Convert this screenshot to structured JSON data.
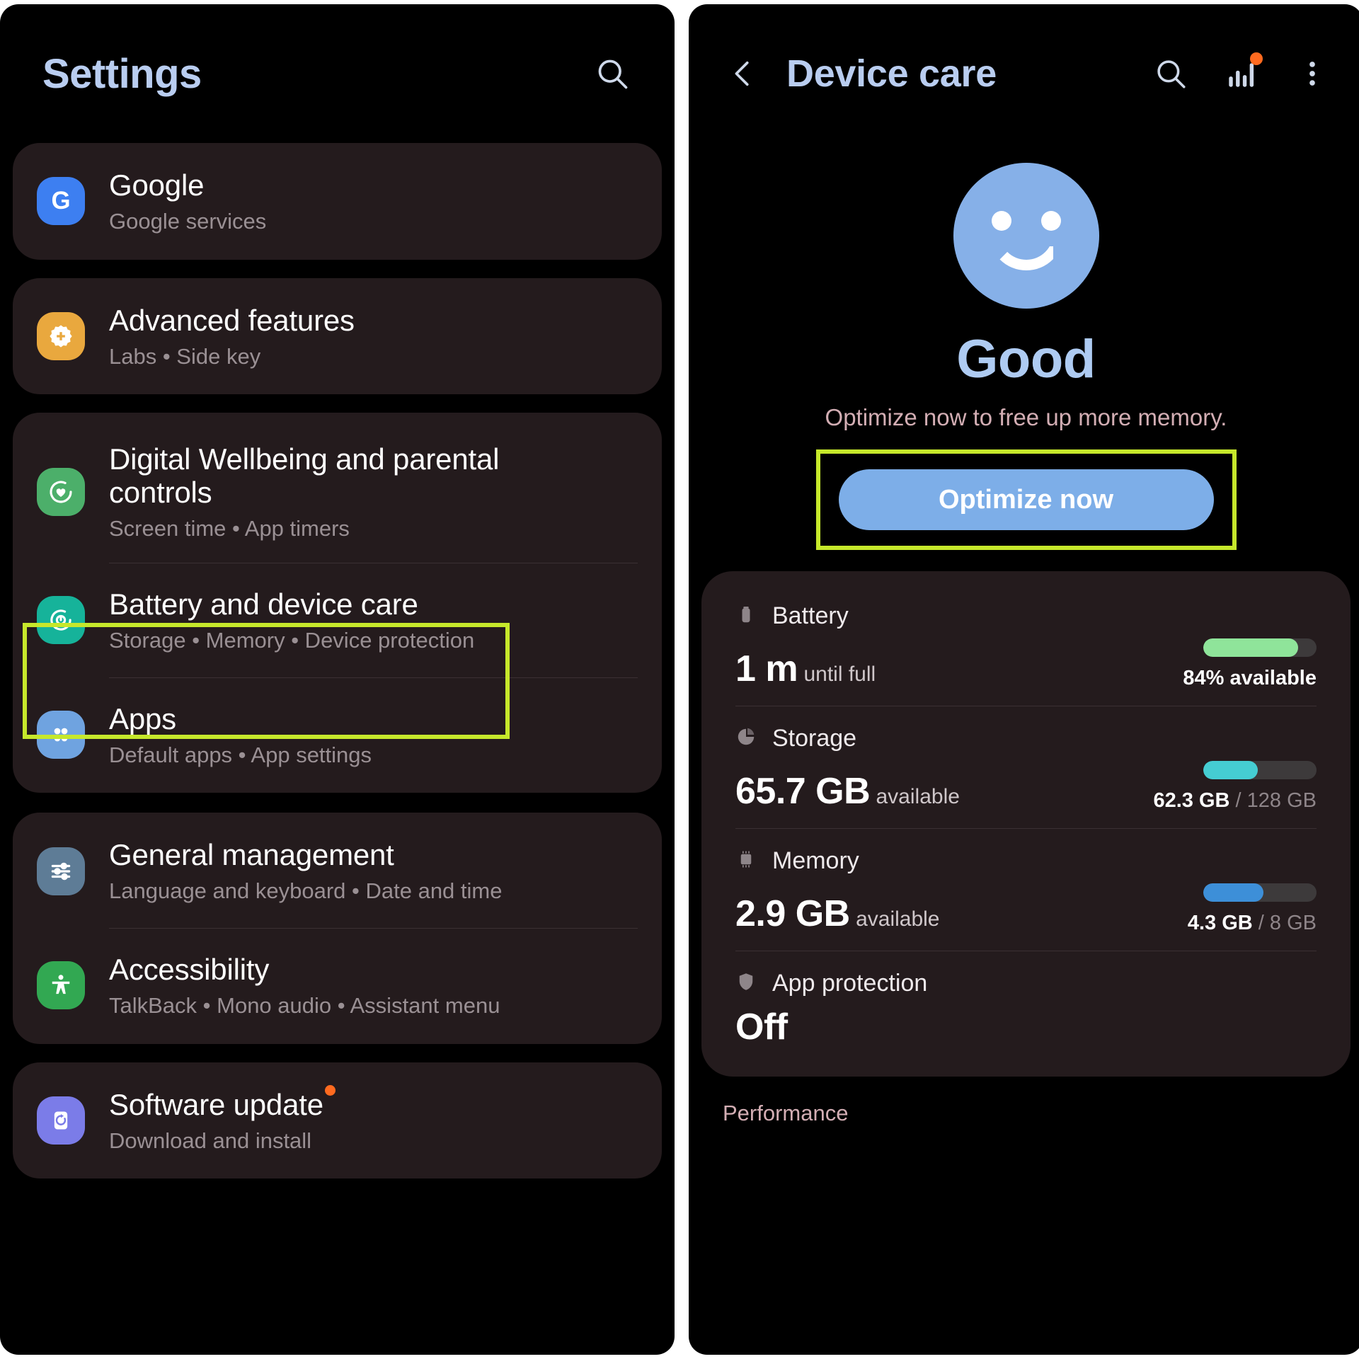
{
  "colors": {
    "accent_blue": "#7daee8",
    "title_blue": "#b9cdf0",
    "highlight_green": "#c6e82b",
    "badge_orange": "#ff6a1f",
    "card_bg": "#241b1d",
    "pink_label": "#d3aeb4",
    "battery_bar": "#8fe49a",
    "storage_bar": "#45cdd2",
    "memory_bar": "#3d8fd8"
  },
  "settings": {
    "header": {
      "title": "Settings",
      "search_icon": "search-icon"
    },
    "groups": [
      {
        "items": [
          {
            "id": "google",
            "title": "Google",
            "subtitle": "Google services",
            "icon": "google-g-icon",
            "icon_bg": "#3d7ff1"
          }
        ]
      },
      {
        "items": [
          {
            "id": "advanced-features",
            "title": "Advanced features",
            "subtitle": "Labs  •  Side key",
            "icon": "gear-plus-icon",
            "icon_bg": "#e9a83e"
          }
        ]
      },
      {
        "items": [
          {
            "id": "digital-wellbeing",
            "title": "Digital Wellbeing and parental controls",
            "subtitle": "Screen time  •  App timers",
            "icon": "heart-circle-icon",
            "icon_bg": "#4caf6a"
          },
          {
            "id": "battery-and-device-care",
            "title": "Battery and device care",
            "subtitle": "Storage  •  Memory  •  Device protection",
            "icon": "device-care-icon",
            "icon_bg": "#16b39a",
            "highlighted": true
          },
          {
            "id": "apps",
            "title": "Apps",
            "subtitle": "Default apps  •  App settings",
            "icon": "apps-grid-icon",
            "icon_bg": "#6fa3e0"
          }
        ]
      },
      {
        "items": [
          {
            "id": "general-management",
            "title": "General management",
            "subtitle": "Language and keyboard  •  Date and time",
            "icon": "sliders-icon",
            "icon_bg": "#5e7c96"
          },
          {
            "id": "accessibility",
            "title": "Accessibility",
            "subtitle": "TalkBack  •  Mono audio  •  Assistant menu",
            "icon": "accessibility-person-icon",
            "icon_bg": "#32a852"
          }
        ]
      },
      {
        "items": [
          {
            "id": "software-update",
            "title": "Software update",
            "subtitle": "Download and install",
            "icon": "software-update-icon",
            "icon_bg": "#7b7ce8",
            "badge": true
          }
        ]
      }
    ]
  },
  "device_care": {
    "header": {
      "back_icon": "chevron-left-icon",
      "title": "Device care",
      "search_icon": "search-icon",
      "chart_icon": "bar-chart-icon",
      "chart_badge": true,
      "overflow_icon": "more-vertical-icon"
    },
    "status": {
      "face_icon": "smiley-face-icon",
      "word": "Good",
      "subtitle": "Optimize now to free up more memory.",
      "button_label": "Optimize now",
      "button_highlighted": true
    },
    "metrics": [
      {
        "id": "battery",
        "icon": "battery-icon",
        "label": "Battery",
        "value": "1 m",
        "value_suffix": "until full",
        "note_strong": "84% available",
        "note_rest": "",
        "bar_percent": 84,
        "bar_color": "#8fe49a"
      },
      {
        "id": "storage",
        "icon": "storage-pie-icon",
        "label": "Storage",
        "value": "65.7 GB",
        "value_suffix": "available",
        "note_strong": "62.3 GB",
        "note_rest": " / 128 GB",
        "bar_percent": 48,
        "bar_color": "#45cdd2"
      },
      {
        "id": "memory",
        "icon": "memory-chip-icon",
        "label": "Memory",
        "value": "2.9 GB",
        "value_suffix": "available",
        "note_strong": "4.3 GB",
        "note_rest": " / 8 GB",
        "bar_percent": 53,
        "bar_color": "#3d8fd8"
      },
      {
        "id": "app-protection",
        "icon": "shield-icon",
        "label": "App protection",
        "value": "Off",
        "value_suffix": "",
        "note_strong": "",
        "note_rest": "",
        "bar_percent": 0,
        "bar_color": ""
      }
    ],
    "performance_section": "Performance"
  }
}
